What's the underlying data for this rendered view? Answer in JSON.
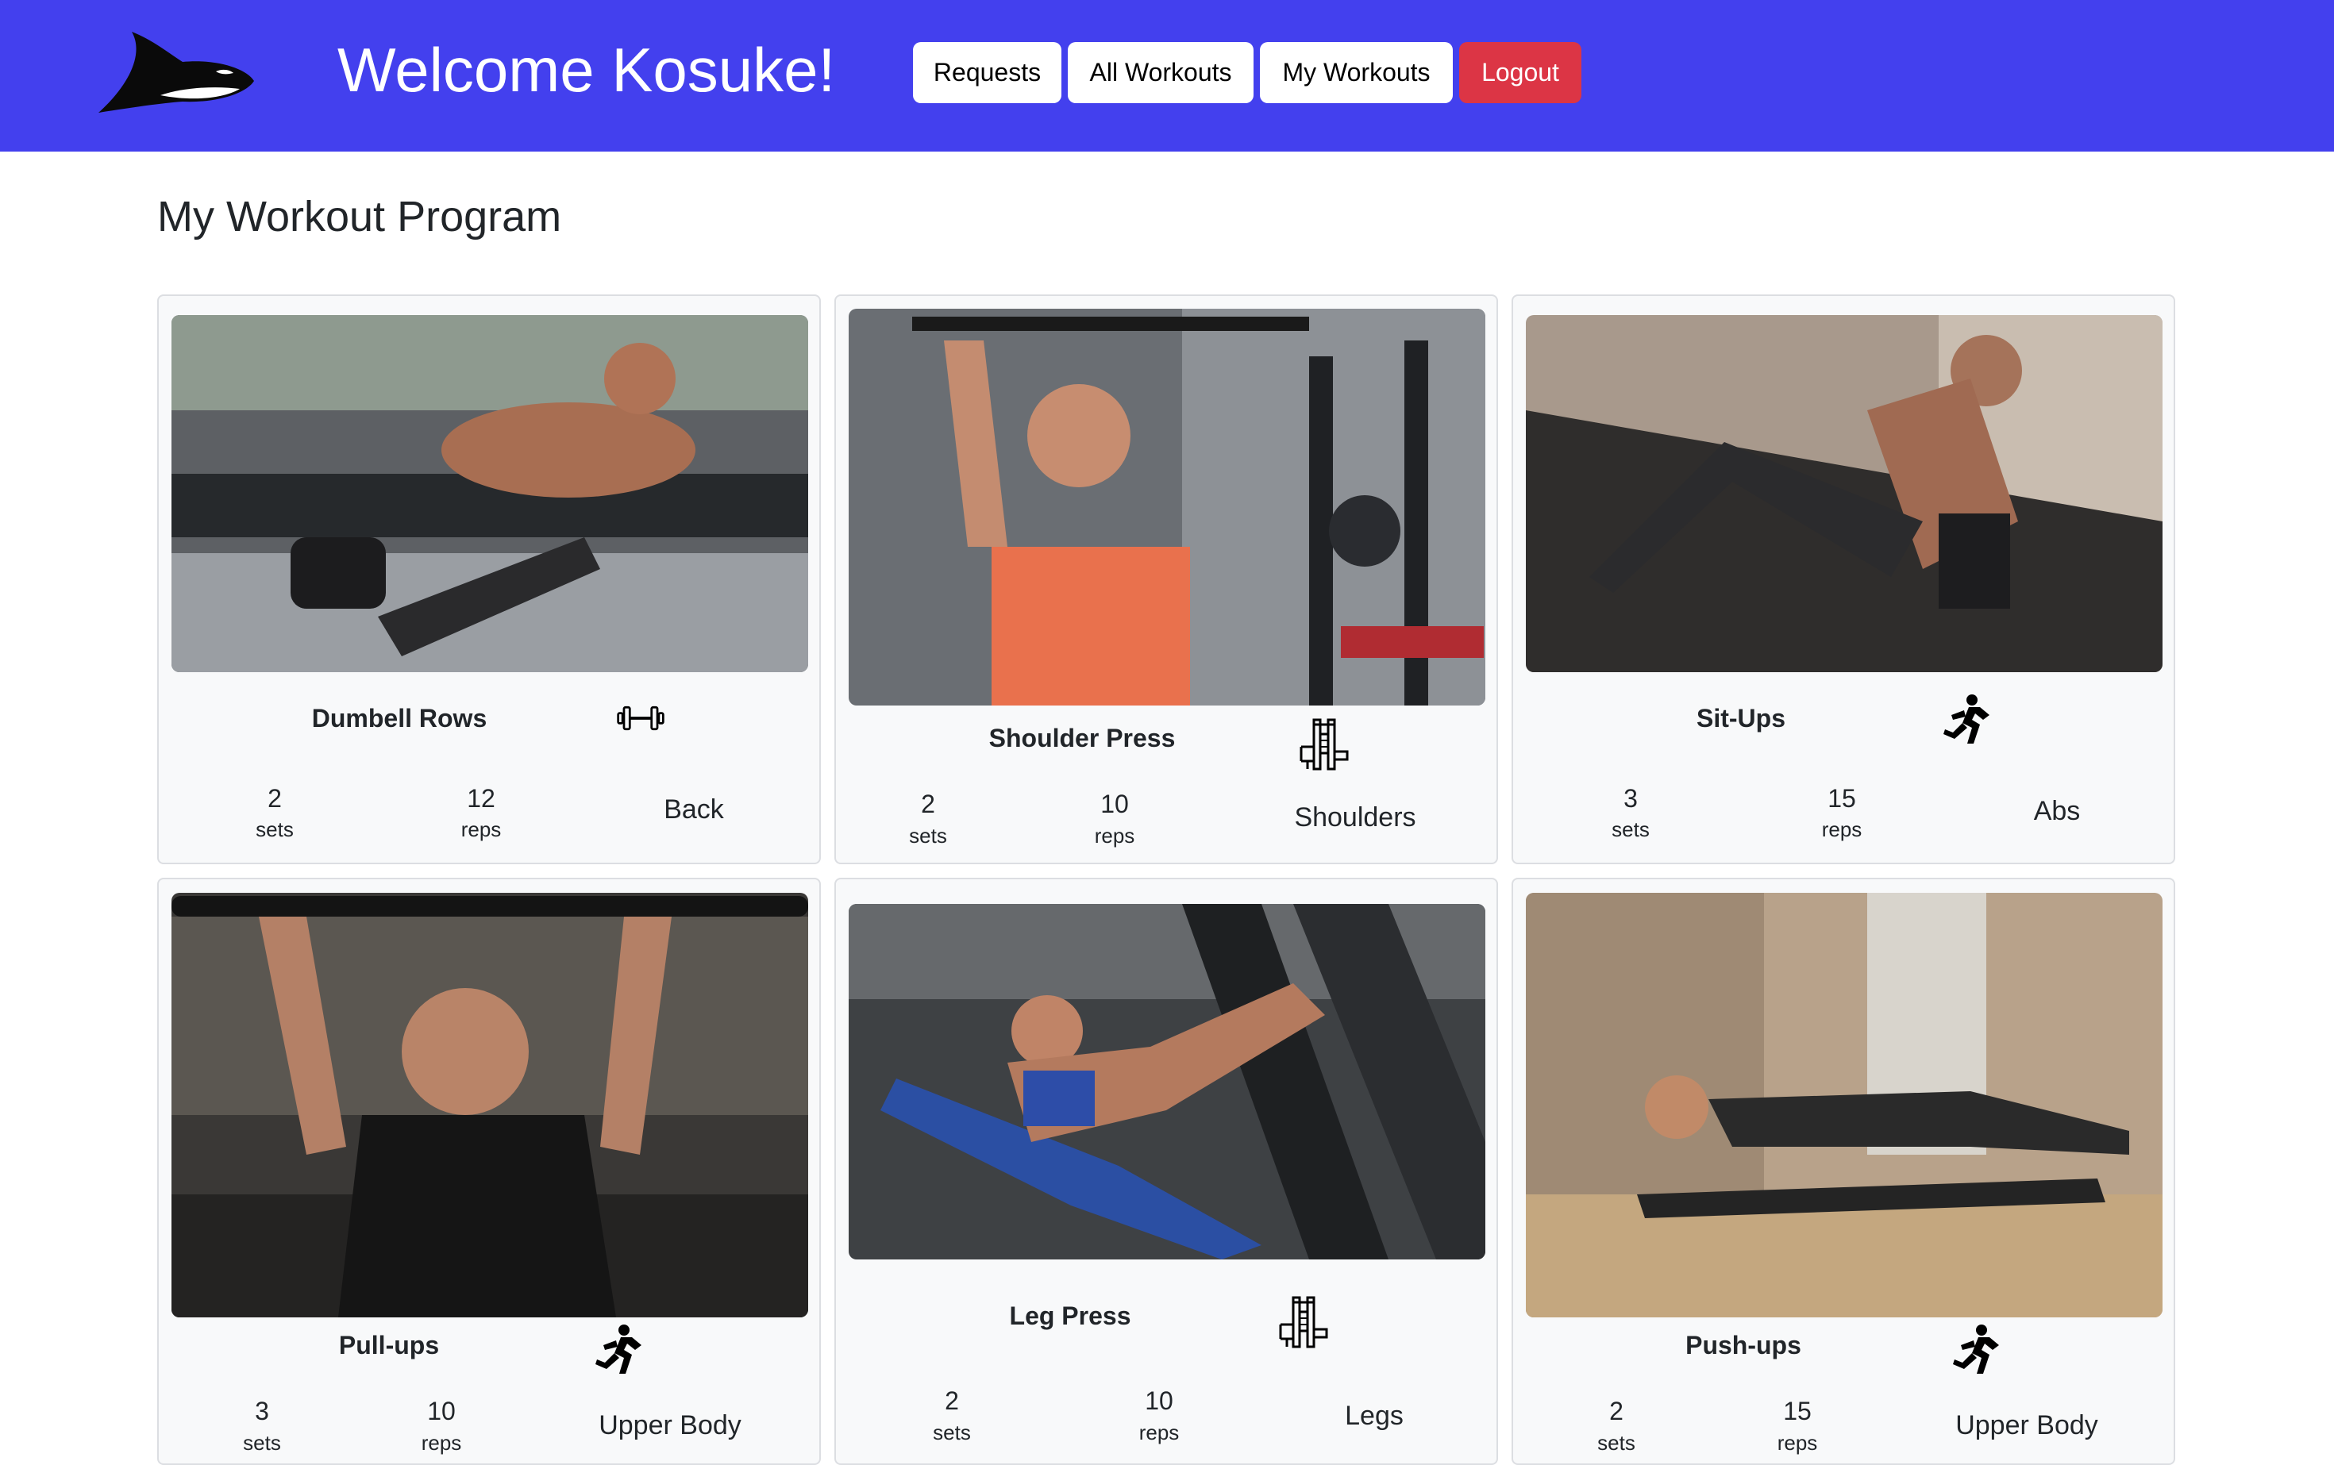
{
  "header": {
    "logo_icon": "orca-logo-icon",
    "welcome": "Welcome Kosuke!",
    "nav": [
      {
        "label": "Requests"
      },
      {
        "label": "All Workouts"
      },
      {
        "label": "My Workouts"
      },
      {
        "label": "Logout"
      }
    ]
  },
  "main": {
    "title": "My Workout Program",
    "workouts": [
      {
        "name": "Dumbell Rows",
        "icon": "dumbbell-icon",
        "sets": "2",
        "sets_label": "sets",
        "reps": "12",
        "reps_label": "reps",
        "muscle": "Back"
      },
      {
        "name": "Shoulder Press",
        "icon": "gym-machine-icon",
        "sets": "2",
        "sets_label": "sets",
        "reps": "10",
        "reps_label": "reps",
        "muscle": "Shoulders"
      },
      {
        "name": "Sit-Ups",
        "icon": "bodyweight-figure-icon",
        "sets": "3",
        "sets_label": "sets",
        "reps": "15",
        "reps_label": "reps",
        "muscle": "Abs"
      },
      {
        "name": "Pull-ups",
        "icon": "bodyweight-figure-icon",
        "sets": "3",
        "sets_label": "sets",
        "reps": "10",
        "reps_label": "reps",
        "muscle": "Upper Body"
      },
      {
        "name": "Leg Press",
        "icon": "gym-machine-icon",
        "sets": "2",
        "sets_label": "sets",
        "reps": "10",
        "reps_label": "reps",
        "muscle": "Legs"
      },
      {
        "name": "Push-ups",
        "icon": "bodyweight-figure-icon",
        "sets": "2",
        "sets_label": "sets",
        "reps": "15",
        "reps_label": "reps",
        "muscle": "Upper Body"
      }
    ]
  },
  "colors": {
    "navbar": "#4340ee",
    "logout": "#dc3545",
    "card_bg": "#f8f9fa"
  }
}
